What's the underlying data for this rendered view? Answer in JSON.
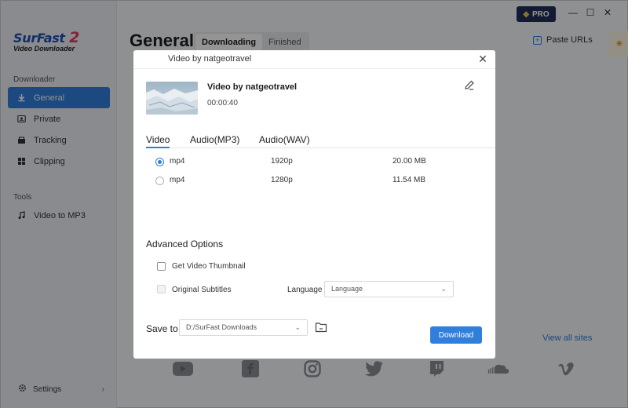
{
  "app": {
    "logo_text": "SurFast",
    "logo_number": "2",
    "logo_subtitle": "Video Downloader",
    "pro_label": "PRO",
    "page_title": "General",
    "tabs": [
      {
        "label": "Downloading",
        "selected": true
      },
      {
        "label": "Finished",
        "selected": false
      }
    ],
    "paste_label": "Paste URLs",
    "view_all_label": "View all sites",
    "sites": [
      "youtube-icon",
      "facebook-icon",
      "instagram-icon",
      "twitter-icon",
      "twitch-icon",
      "soundcloud-icon",
      "vimeo-icon"
    ]
  },
  "sidebar": {
    "downloader_section": "Downloader",
    "items": [
      {
        "label": "General",
        "icon": "download-icon",
        "active": true
      },
      {
        "label": "Private",
        "icon": "private-icon",
        "active": false
      },
      {
        "label": "Tracking",
        "icon": "tracking-icon",
        "active": false
      },
      {
        "label": "Clipping",
        "icon": "clipping-icon",
        "active": false
      }
    ],
    "tools_section": "Tools",
    "tools": [
      {
        "label": "Video to MP3",
        "icon": "music-note-icon"
      }
    ],
    "settings_label": "Settings"
  },
  "dialog": {
    "title": "Video by natgeotravel",
    "video_title": "Video by natgeotravel",
    "duration": "00:00:40",
    "format_tabs": [
      {
        "label": "Video",
        "selected": true
      },
      {
        "label": "Audio(MP3)",
        "selected": false
      },
      {
        "label": "Audio(WAV)",
        "selected": false
      }
    ],
    "options": [
      {
        "format": "mp4",
        "resolution": "1920p",
        "size": "20.00 MB",
        "selected": true
      },
      {
        "format": "mp4",
        "resolution": "1280p",
        "size": "11.54 MB",
        "selected": false
      }
    ],
    "advanced_title": "Advanced Options",
    "thumbnail_label": "Get Video Thumbnail",
    "subtitles_label": "Original Subtitles",
    "language_label": "Language",
    "language_placeholder": "Language",
    "save_to_label": "Save to",
    "save_path": "D:/SurFast Downloads",
    "download_label": "Download"
  },
  "colors": {
    "accent": "#2f7fdc",
    "pro_bg": "#1f2d5a",
    "logo_blue": "#1f4fb5",
    "logo_red": "#e23c5b"
  }
}
